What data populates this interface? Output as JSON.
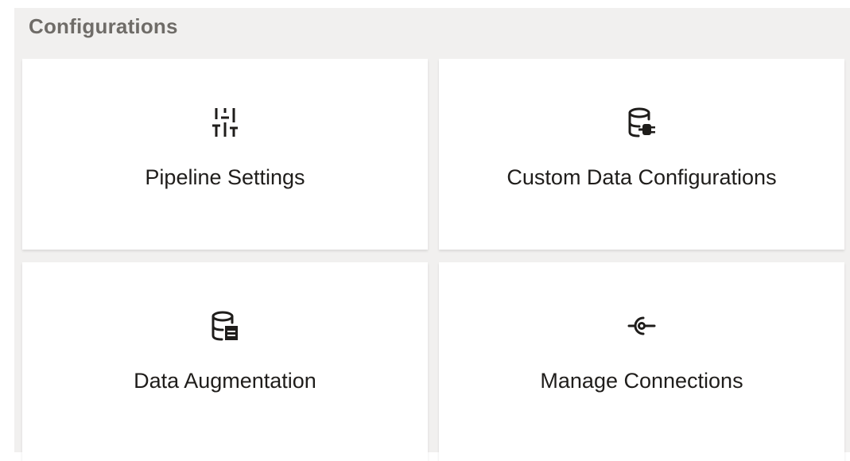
{
  "section": {
    "title": "Configurations"
  },
  "cards": [
    {
      "label": "Pipeline Settings",
      "icon": "sliders-icon"
    },
    {
      "label": "Custom Data Configurations",
      "icon": "database-plug-icon"
    },
    {
      "label": "Data Augmentation",
      "icon": "database-table-icon"
    },
    {
      "label": "Manage Connections",
      "icon": "connection-icon"
    }
  ],
  "colors": {
    "panel_background": "#f1f0ef",
    "card_background": "#ffffff",
    "title_text": "#6f6c68",
    "label_text": "#1f1d1b"
  }
}
